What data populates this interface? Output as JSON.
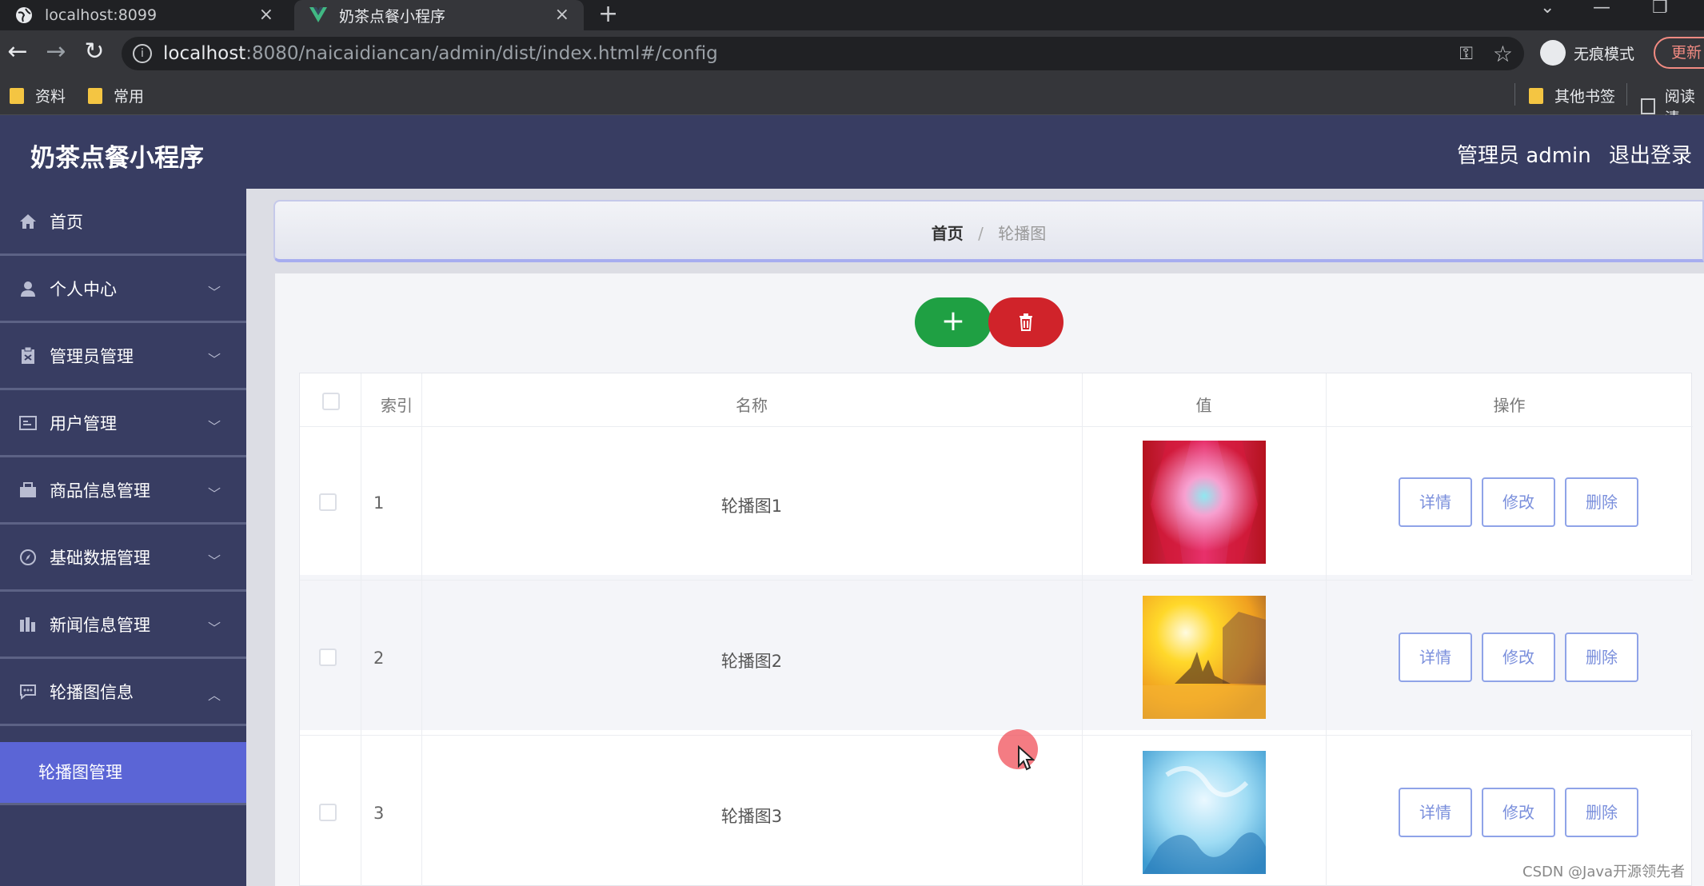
{
  "browser": {
    "tabs": [
      {
        "title": "localhost:8099",
        "close": "×"
      },
      {
        "title": "奶茶点餐小程序",
        "close": "×"
      }
    ],
    "new_tab": "+",
    "url_host": "localhost",
    "url_rest": ":8080/naicaidiancan/admin/dist/index.html#/config",
    "incognito_label": "无痕模式",
    "update_label": "更新",
    "bookmarks": [
      {
        "label": "资料"
      },
      {
        "label": "常用"
      },
      {
        "label": "其他书签"
      },
      {
        "label": "阅读清"
      }
    ]
  },
  "header": {
    "title": "奶茶点餐小程序",
    "admin": "管理员 admin",
    "logout": "退出登录"
  },
  "sidebar": {
    "items": [
      {
        "label": "首页",
        "icon": "home-icon"
      },
      {
        "label": "个人中心",
        "icon": "user-icon"
      },
      {
        "label": "管理员管理",
        "icon": "clipboard-icon"
      },
      {
        "label": "用户管理",
        "icon": "id-card-icon"
      },
      {
        "label": "商品信息管理",
        "icon": "box-icon"
      },
      {
        "label": "基础数据管理",
        "icon": "compass-icon"
      },
      {
        "label": "新闻信息管理",
        "icon": "bar-chart-icon"
      },
      {
        "label": "轮播图信息",
        "icon": "message-icon"
      }
    ],
    "active_sub": "轮播图管理"
  },
  "breadcrumb": {
    "home": "首页",
    "sep": "/",
    "current": "轮播图"
  },
  "toolbar": {
    "add_label": "+"
  },
  "table": {
    "headers": {
      "index": "索引",
      "name": "名称",
      "value": "值",
      "actions": "操作"
    },
    "rows": [
      {
        "index": "1",
        "name": "轮播图1"
      },
      {
        "index": "2",
        "name": "轮播图2"
      },
      {
        "index": "3",
        "name": "轮播图3"
      }
    ],
    "actions": {
      "detail": "详情",
      "edit": "修改",
      "delete": "删除"
    }
  },
  "watermark": "CSDN @Java开源领先者",
  "colors": {
    "header_bg": "#383d62",
    "active_menu": "#5b65d6",
    "add_button": "#1fa043",
    "delete_button": "#d0232a",
    "action_border": "#8fa3e8"
  }
}
